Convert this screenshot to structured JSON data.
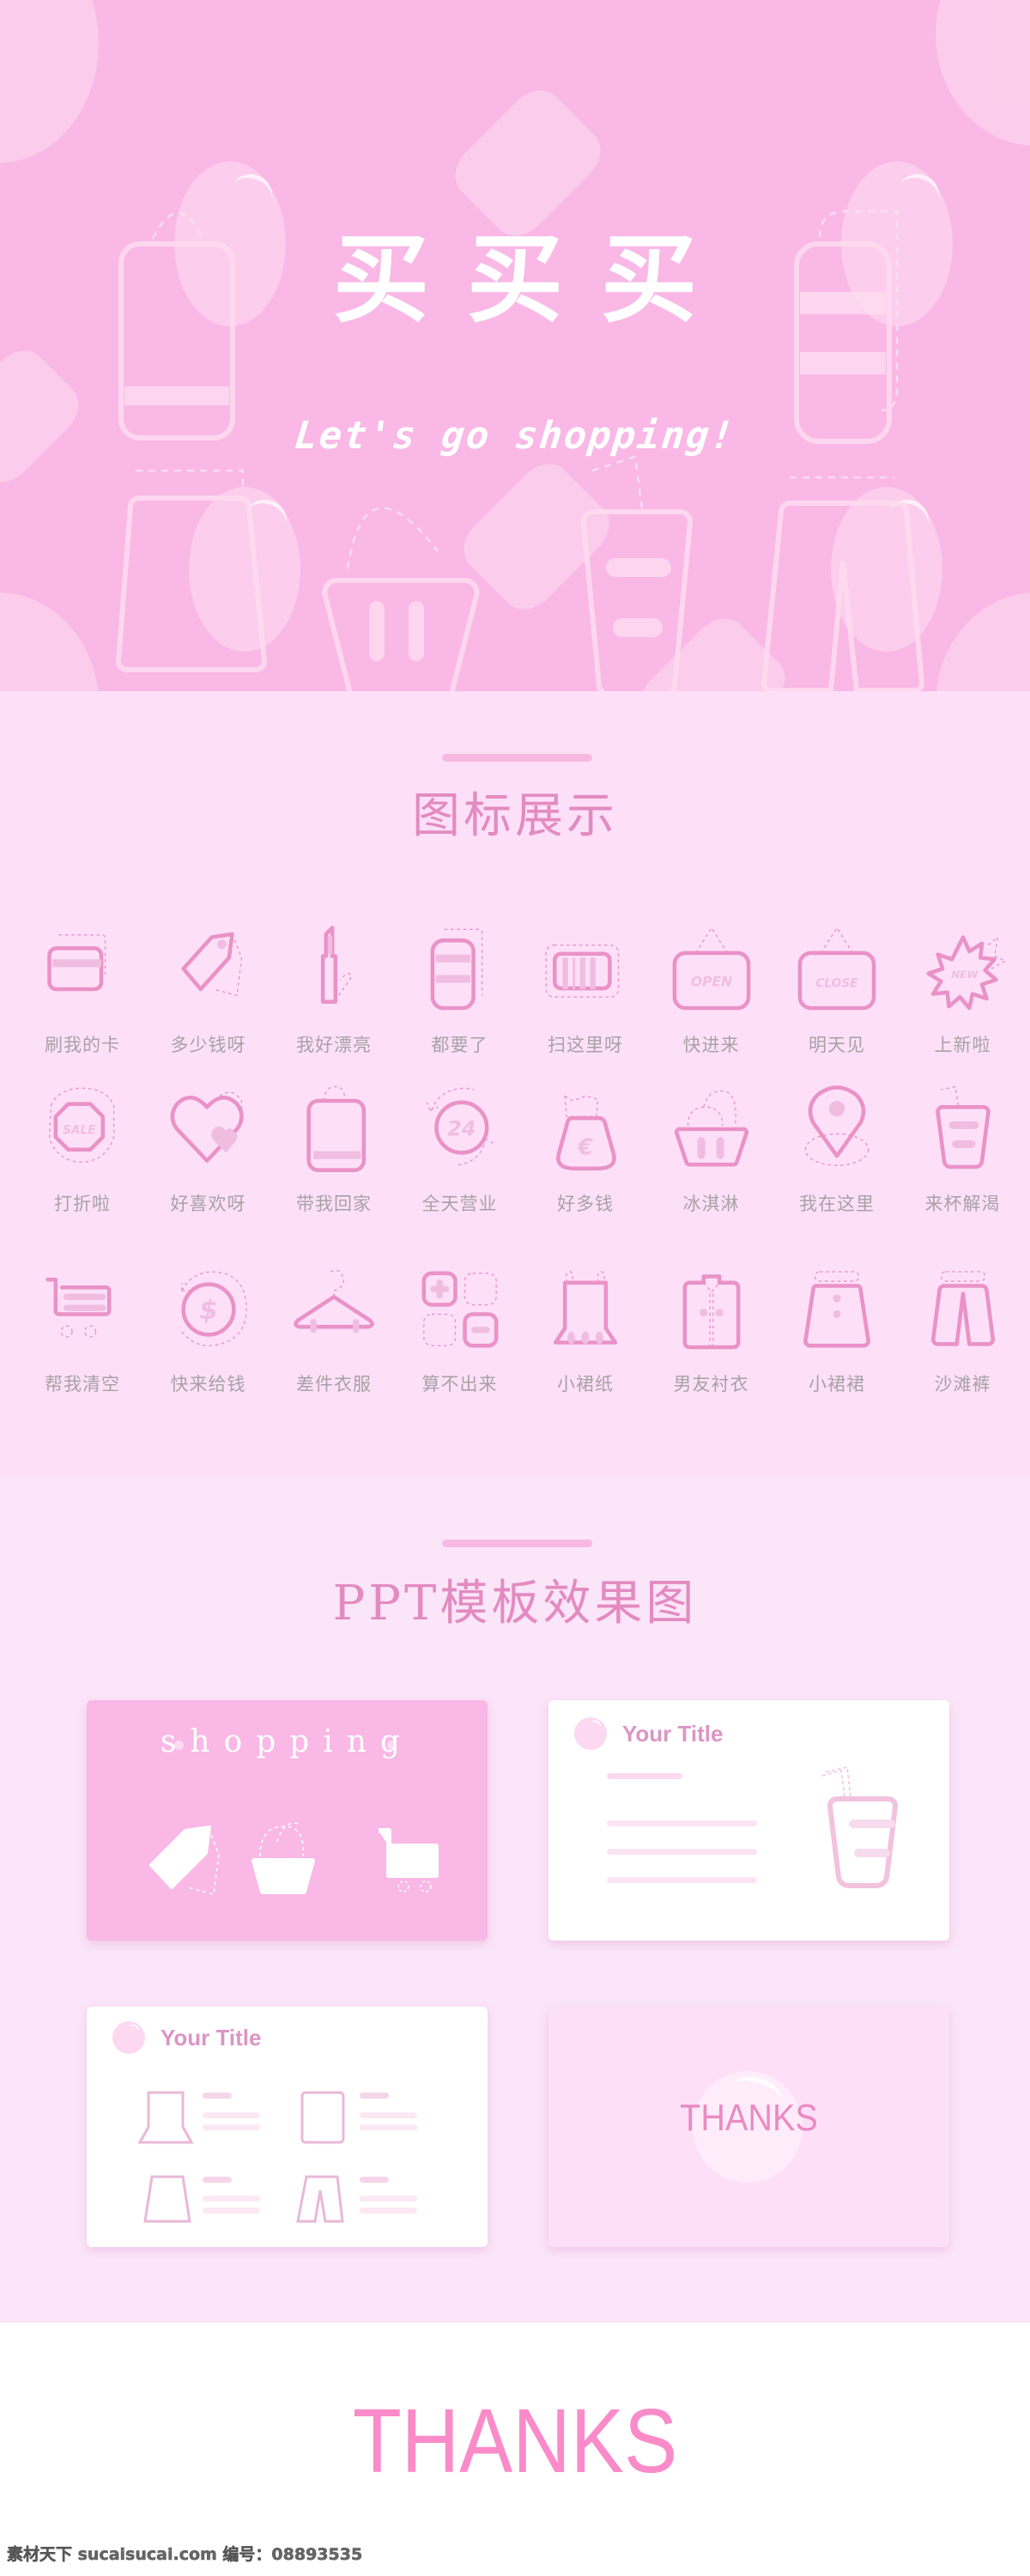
{
  "hero": {
    "title": "买买买",
    "subtitle": "Let's go shopping!"
  },
  "icons_section": {
    "title": "图标展示",
    "icons": [
      {
        "icon": "credit-card-icon",
        "label": "刷我的卡"
      },
      {
        "icon": "price-tag-icon",
        "label": "多少钱呀"
      },
      {
        "icon": "lipstick-icon",
        "label": "我好漂亮"
      },
      {
        "icon": "phone-list-icon",
        "label": "都要了"
      },
      {
        "icon": "barcode-icon",
        "label": "扫这里呀"
      },
      {
        "icon": "open-sign-icon",
        "label": "快进来",
        "sign_text": "OPEN"
      },
      {
        "icon": "close-sign-icon",
        "label": "明天见",
        "sign_text": "CLOSE"
      },
      {
        "icon": "new-badge-icon",
        "label": "上新啦",
        "sign_text": "NEW"
      },
      {
        "icon": "sale-octagon-icon",
        "label": "打折啦",
        "sign_text": "SALE"
      },
      {
        "icon": "heart-icon",
        "label": "好喜欢呀"
      },
      {
        "icon": "shopping-bag-icon",
        "label": "带我回家"
      },
      {
        "icon": "24-hours-icon",
        "label": "全天营业",
        "sign_text": "24"
      },
      {
        "icon": "money-bag-icon",
        "label": "好多钱",
        "sign_text": "€"
      },
      {
        "icon": "ice-cream-basket-icon",
        "label": "冰淇淋"
      },
      {
        "icon": "location-pin-icon",
        "label": "我在这里"
      },
      {
        "icon": "drink-cup-icon",
        "label": "来杯解渴"
      },
      {
        "icon": "shopping-cart-icon",
        "label": "帮我清空"
      },
      {
        "icon": "dollar-coin-icon",
        "label": "快来给钱",
        "sign_text": "$"
      },
      {
        "icon": "hanger-icon",
        "label": "差件衣服"
      },
      {
        "icon": "calculator-icon",
        "label": "算不出来"
      },
      {
        "icon": "camisole-dress-icon",
        "label": "小裙纸"
      },
      {
        "icon": "shirt-icon",
        "label": "男友衬衣"
      },
      {
        "icon": "skirt-icon",
        "label": "小裙裙"
      },
      {
        "icon": "shorts-icon",
        "label": "沙滩裤"
      }
    ]
  },
  "ppt_section": {
    "title": "PPT模板效果图",
    "cards": [
      {
        "type": "cover",
        "text": "shopping"
      },
      {
        "type": "content",
        "title": "Your Title"
      },
      {
        "type": "content-grid",
        "title": "Your Title"
      },
      {
        "type": "thanks",
        "text": "THANKS"
      }
    ]
  },
  "footer": {
    "thanks": "THANKS",
    "watermark": "素材天下 sucaisucai.com  编号：08893535"
  },
  "colors": {
    "hero_bg": "#f9b8e6",
    "icons_bg": "#fde0f8",
    "ppt_bg": "#fbe5f8",
    "icon_stroke": "#ea92c7",
    "icon_fill_soft": "#f0bde0",
    "label_gray": "#a7a2a6",
    "thanks_pink": "#fa8bc9"
  }
}
